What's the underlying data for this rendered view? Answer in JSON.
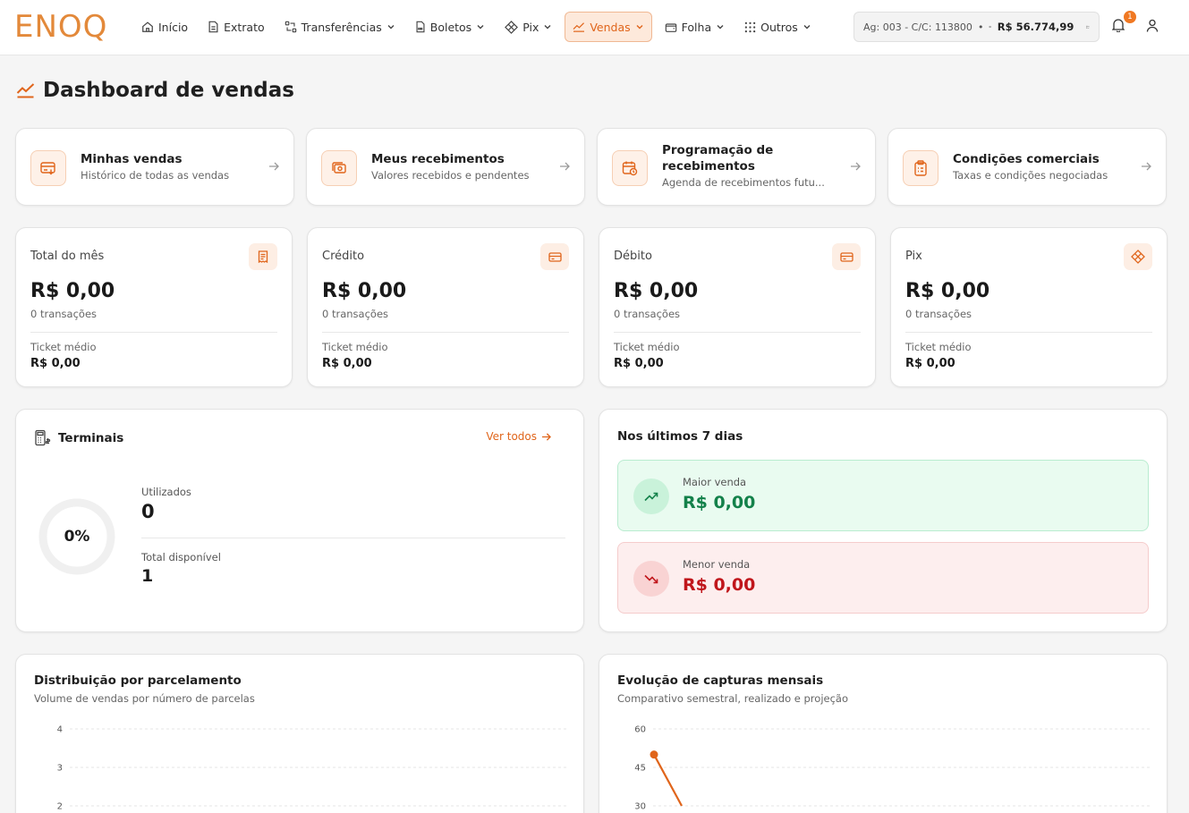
{
  "brand": {
    "logo_text": "ENOQ",
    "accent": "#e0651b"
  },
  "nav": {
    "items": [
      {
        "label": "Início",
        "icon": "home-icon",
        "has_dropdown": false,
        "active": false
      },
      {
        "label": "Extrato",
        "icon": "document-icon",
        "has_dropdown": false,
        "active": false
      },
      {
        "label": "Transferências",
        "icon": "transfer-icon",
        "has_dropdown": true,
        "active": false
      },
      {
        "label": "Boletos",
        "icon": "barcode-doc-icon",
        "has_dropdown": true,
        "active": false
      },
      {
        "label": "Pix",
        "icon": "pix-icon",
        "has_dropdown": true,
        "active": false
      },
      {
        "label": "Vendas",
        "icon": "trend-icon",
        "has_dropdown": true,
        "active": true
      },
      {
        "label": "Folha",
        "icon": "wallet-icon",
        "has_dropdown": true,
        "active": false
      },
      {
        "label": "Outros",
        "icon": "grid-icon",
        "has_dropdown": true,
        "active": false
      }
    ]
  },
  "account": {
    "info": "Ag: 003 - C/C: 113800",
    "separator": "•",
    "balance": "R$ 56.774,99"
  },
  "notifications": {
    "count": "1"
  },
  "page": {
    "title": "Dashboard de vendas"
  },
  "quick_cards": [
    {
      "title": "Minhas vendas",
      "subtitle": "Histórico de todas as vendas",
      "icon": "sales-card-icon"
    },
    {
      "title": "Meus recebimentos",
      "subtitle": "Valores recebidos e pendentes",
      "icon": "money-icon"
    },
    {
      "title": "Programação de recebimentos",
      "subtitle": "Agenda de recebimentos futu...",
      "icon": "calendar-clock-icon"
    },
    {
      "title": "Condições comerciais",
      "subtitle": "Taxas e condições negociadas",
      "icon": "clipboard-icon"
    }
  ],
  "stats": [
    {
      "label": "Total do mês",
      "value": "R$ 0,00",
      "count": "0 transações",
      "ticket_label": "Ticket médio",
      "ticket_value": "R$ 0,00",
      "icon": "receipt-icon"
    },
    {
      "label": "Crédito",
      "value": "R$ 0,00",
      "count": "0 transações",
      "ticket_label": "Ticket médio",
      "ticket_value": "R$ 0,00",
      "icon": "credit-card-icon"
    },
    {
      "label": "Débito",
      "value": "R$ 0,00",
      "count": "0 transações",
      "ticket_label": "Ticket médio",
      "ticket_value": "R$ 0,00",
      "icon": "debit-card-icon"
    },
    {
      "label": "Pix",
      "value": "R$ 0,00",
      "count": "0 transações",
      "ticket_label": "Ticket médio",
      "ticket_value": "R$ 0,00",
      "icon": "pix-icon"
    }
  ],
  "terminals": {
    "title": "Terminais",
    "link": "Ver todos",
    "percent": "0%",
    "usage_fraction": 0,
    "used_label": "Utilizados",
    "used_value": "0",
    "available_label": "Total disponível",
    "available_value": "1"
  },
  "last7": {
    "title": "Nos últimos 7 dias",
    "max_label": "Maior venda",
    "max_value": "R$ 0,00",
    "min_label": "Menor venda",
    "min_value": "R$ 0,00",
    "colors": {
      "positive": "#13814a",
      "negative": "#c0161b"
    }
  },
  "charts": {
    "installments": {
      "title": "Distribuição por parcelamento",
      "subtitle": "Volume de vendas por número de parcelas"
    },
    "monthly": {
      "title": "Evolução de capturas mensais",
      "subtitle": "Comparativo semestral, realizado e projeção"
    }
  },
  "chart_data": [
    {
      "type": "bar",
      "title": "Distribuição por parcelamento",
      "subtitle": "Volume de vendas por número de parcelas",
      "y_ticks": [
        4,
        3,
        2
      ],
      "ylim": [
        0,
        4
      ],
      "grid": true,
      "categories": [],
      "values": []
    },
    {
      "type": "line",
      "title": "Evolução de capturas mensais",
      "subtitle": "Comparativo semestral, realizado e projeção",
      "y_ticks": [
        60,
        45,
        30
      ],
      "ylim": [
        0,
        60
      ],
      "grid": true,
      "series": [
        {
          "values": [
            50,
            30
          ],
          "color": "#e0651b"
        }
      ]
    }
  ]
}
